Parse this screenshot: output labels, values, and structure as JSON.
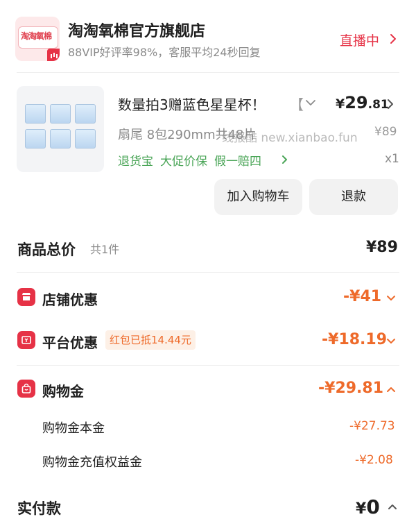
{
  "store": {
    "name": "淘淘氧棉官方旗舰店",
    "subtitle": "88VIP好评率98%，客服平均24秒回复",
    "live_label": "直播中",
    "logo_text": "淘淘氧棉"
  },
  "product": {
    "title": "数量拍3赠蓝色星星杯！",
    "title_overflow": "【",
    "sku": "扇尾 8包290mm共48片",
    "price_currency": "¥",
    "price_int": "29",
    "price_dec": ".81",
    "original_price": "¥89",
    "services": [
      "退货宝",
      "大促价保",
      "假一赔四"
    ],
    "quantity": "x1"
  },
  "watermark": "线报酷 new.xianbao.fun",
  "actions": {
    "add_to_cart": "加入购物车",
    "refund": "退款"
  },
  "summary": {
    "total_label": "商品总价",
    "total_count": "共1件",
    "total_value": "¥89",
    "store_discount_label": "店铺优惠",
    "store_discount_value": "-¥41",
    "platform_discount_label": "平台优惠",
    "platform_discount_tag": "红包已抵14.44元",
    "platform_discount_value": "-¥18.19",
    "shopping_credit_label": "购物金",
    "shopping_credit_value": "-¥29.81",
    "credit_principal_label": "购物金本金",
    "credit_principal_value": "-¥27.73",
    "credit_bonus_label": "购物金充值权益金",
    "credit_bonus_value": "-¥2.08",
    "paid_label": "实付款",
    "paid_currency": "¥",
    "paid_value": "0"
  },
  "colors": {
    "brand_red": "#e63246",
    "discount_orange": "#ee6a2a",
    "service_green": "#4aa557",
    "muted_gray": "#8a8a8a"
  }
}
